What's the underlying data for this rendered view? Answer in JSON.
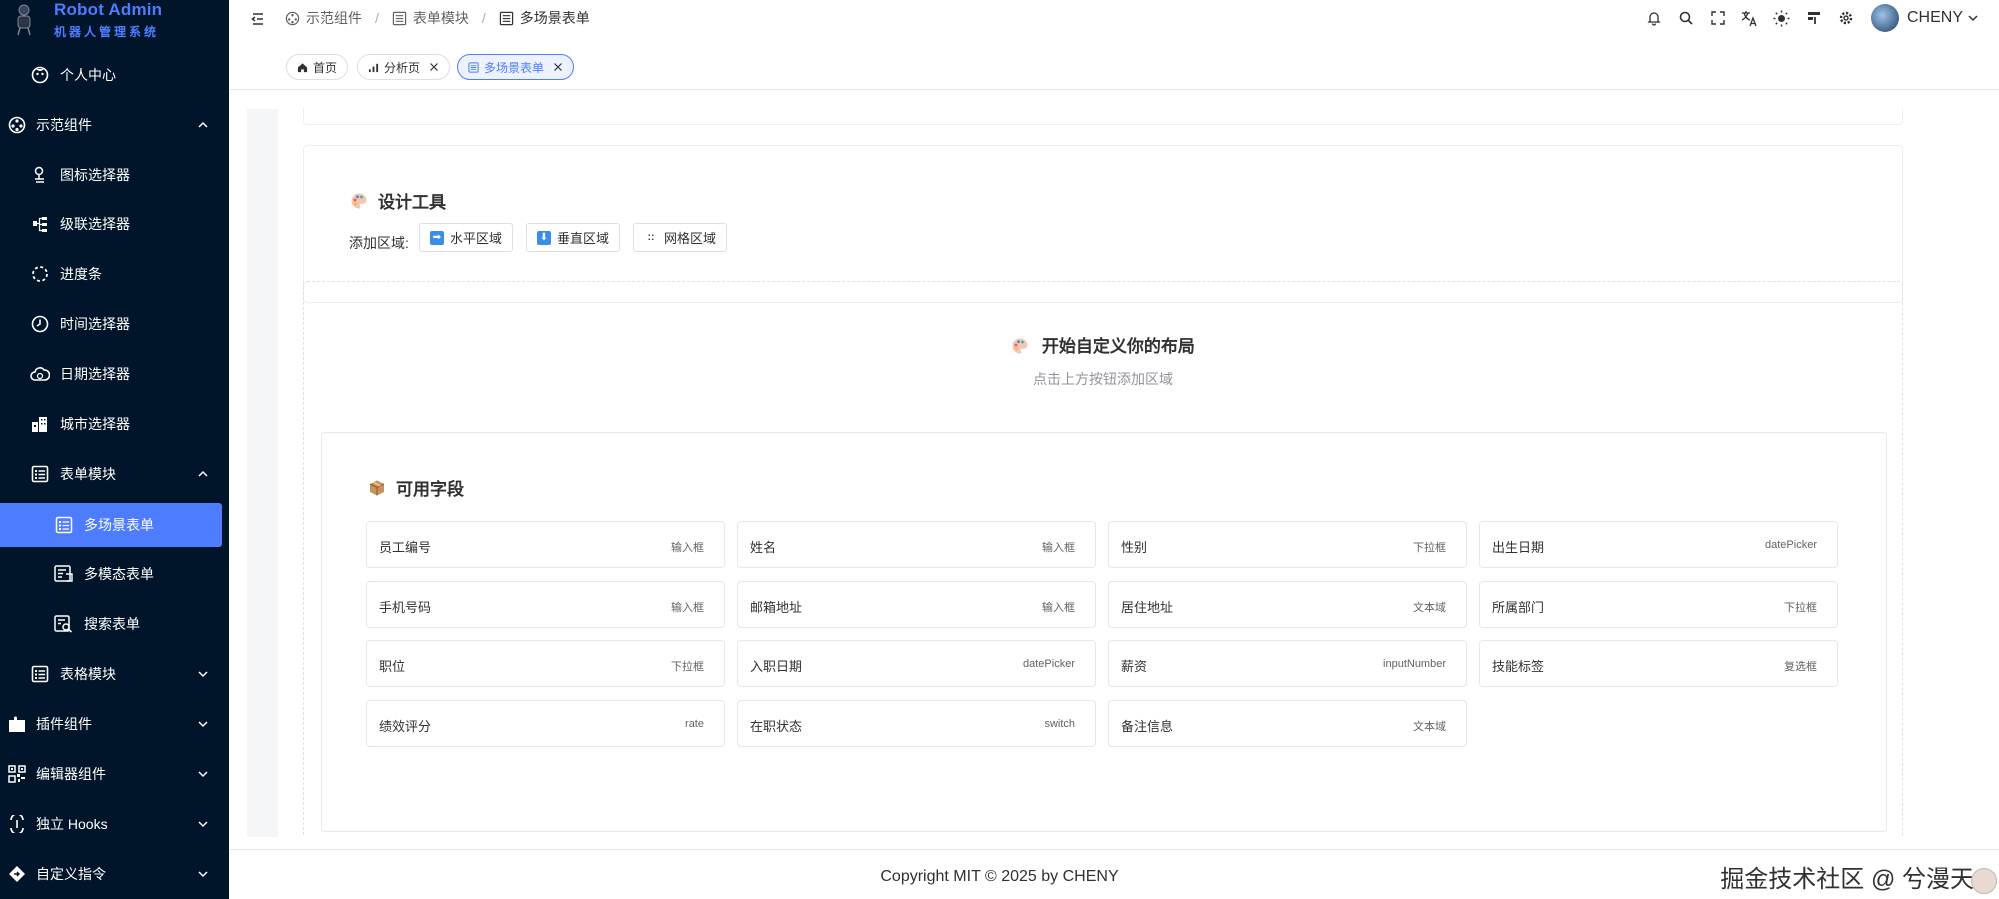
{
  "brand": {
    "title": "Robot Admin",
    "subtitle": "机器人管理系统"
  },
  "sidebar": {
    "items": [
      {
        "label": "个人中心",
        "icon": "user-face-icon"
      },
      {
        "label": "示范组件",
        "icon": "component-icon",
        "expanded": true
      },
      {
        "label": "图标选择器",
        "icon": "icon-picker-icon"
      },
      {
        "label": "级联选择器",
        "icon": "cascader-icon"
      },
      {
        "label": "进度条",
        "icon": "progress-circle-icon"
      },
      {
        "label": "时间选择器",
        "icon": "clock-icon"
      },
      {
        "label": "日期选择器",
        "icon": "cloud-date-icon"
      },
      {
        "label": "城市选择器",
        "icon": "city-icon"
      },
      {
        "label": "表单模块",
        "icon": "form-icon",
        "expanded": true
      },
      {
        "label": "多场景表单",
        "icon": "list-form-icon",
        "active": true
      },
      {
        "label": "多模态表单",
        "icon": "multimodal-form-icon"
      },
      {
        "label": "搜索表单",
        "icon": "search-form-icon"
      },
      {
        "label": "表格模块",
        "icon": "table-icon",
        "expanded": false
      },
      {
        "label": "插件组件",
        "icon": "plugin-icon",
        "expanded": false
      },
      {
        "label": "编辑器组件",
        "icon": "qr-editor-icon",
        "expanded": false
      },
      {
        "label": "独立 Hooks",
        "icon": "hooks-icon",
        "expanded": false
      },
      {
        "label": "自定义指令",
        "icon": "directive-icon",
        "expanded": false
      }
    ]
  },
  "header": {
    "breadcrumb": [
      {
        "label": "示范组件",
        "icon": "component-icon"
      },
      {
        "label": "表单模块",
        "icon": "form-icon"
      },
      {
        "label": "多场景表单",
        "icon": "list-form-icon"
      }
    ],
    "username": "CHENY",
    "tools": [
      "bell-icon",
      "search-icon",
      "fullscreen-icon",
      "translate-icon",
      "theme-sun-icon",
      "layout-icon",
      "settings-icon"
    ]
  },
  "tabs": [
    {
      "label": "首页",
      "icon": "home-icon",
      "closable": false,
      "active": false
    },
    {
      "label": "分析页",
      "icon": "chart-icon",
      "closable": true,
      "active": false
    },
    {
      "label": "多场景表单",
      "icon": "list-form-icon",
      "closable": true,
      "active": true
    }
  ],
  "design_tools": {
    "title": "设计工具",
    "add_area_label": "添加区域:",
    "buttons": [
      {
        "label": "水平区域",
        "icon": "arrow-right-icon",
        "glyph": "➡"
      },
      {
        "label": "垂直区域",
        "icon": "arrow-down-icon",
        "glyph": "⬇"
      },
      {
        "label": "网格区域",
        "icon": "grid-icon",
        "glyph": "::"
      }
    ]
  },
  "layout_canvas": {
    "title": "开始自定义你的布局",
    "subtitle": "点击上方按钮添加区域"
  },
  "available_fields": {
    "title": "可用字段",
    "fields": [
      {
        "name": "员工编号",
        "type": "输入框"
      },
      {
        "name": "姓名",
        "type": "输入框"
      },
      {
        "name": "性别",
        "type": "下拉框"
      },
      {
        "name": "出生日期",
        "type": "datePicker"
      },
      {
        "name": "手机号码",
        "type": "输入框"
      },
      {
        "name": "邮箱地址",
        "type": "输入框"
      },
      {
        "name": "居住地址",
        "type": "文本域"
      },
      {
        "name": "所属部门",
        "type": "下拉框"
      },
      {
        "name": "职位",
        "type": "下拉框"
      },
      {
        "name": "入职日期",
        "type": "datePicker"
      },
      {
        "name": "薪资",
        "type": "inputNumber"
      },
      {
        "name": "技能标签",
        "type": "复选框"
      },
      {
        "name": "绩效评分",
        "type": "rate"
      },
      {
        "name": "在职状态",
        "type": "switch"
      },
      {
        "name": "备注信息",
        "type": "文本域"
      }
    ]
  },
  "footer": {
    "copyright": "Copyright MIT © 2025 by CHENY",
    "watermark": "掘金技术社区 @ 兮漫天"
  },
  "colors": {
    "sidebar_bg": "#001529",
    "accent": "#4d7cfe",
    "brand": "#4d7cfe"
  }
}
